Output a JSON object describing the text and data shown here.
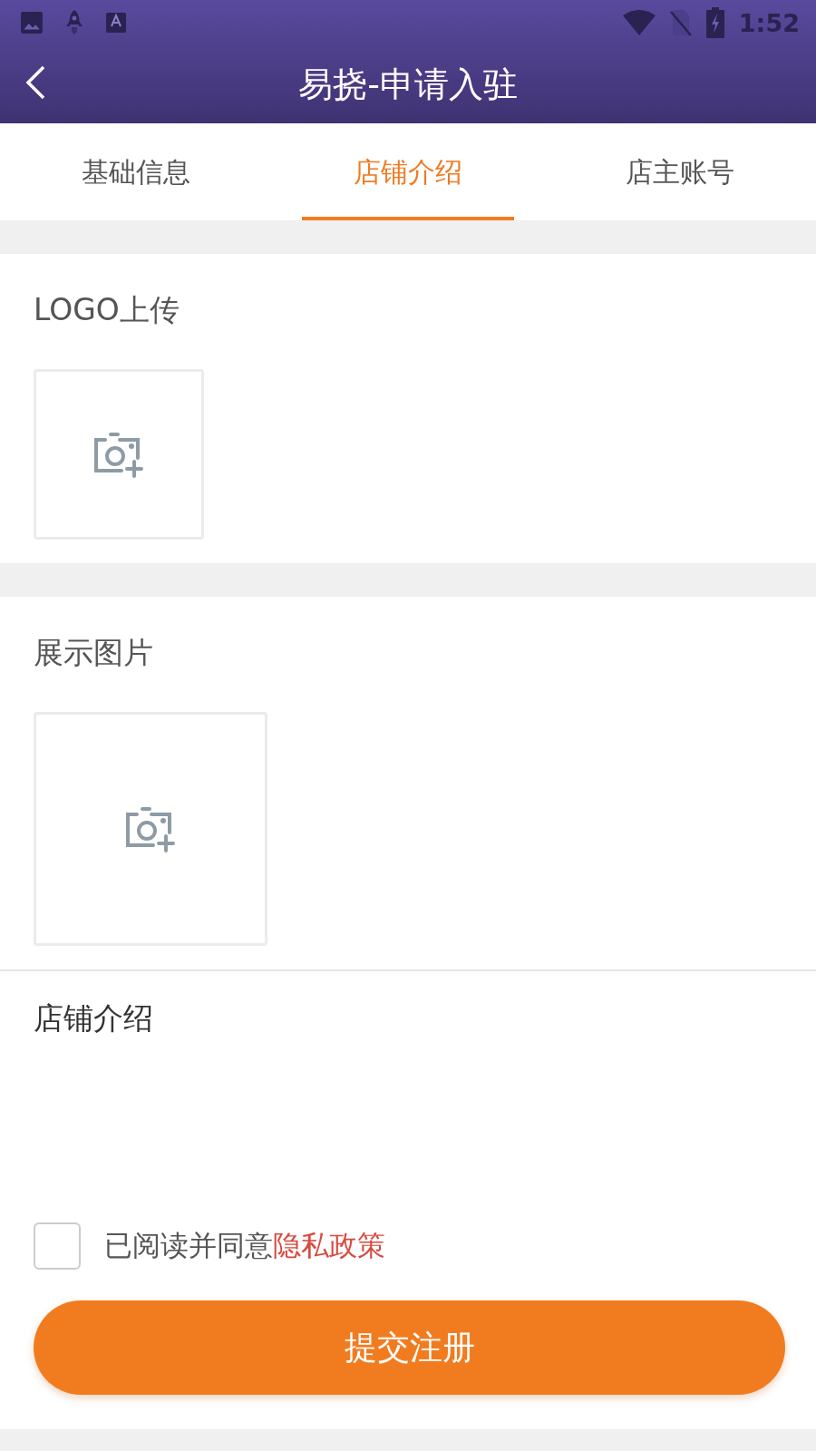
{
  "status_bar": {
    "time": "1:52"
  },
  "header": {
    "title": "易挠-申请入驻"
  },
  "tabs": [
    {
      "label": "基础信息",
      "selected": false
    },
    {
      "label": "店铺介绍",
      "selected": true
    },
    {
      "label": "店主账号",
      "selected": false
    }
  ],
  "sections": [
    {
      "kind": "logo",
      "label": "LOGO上传"
    },
    {
      "kind": "gallery",
      "label": "展示图片"
    },
    {
      "kind": "text",
      "label": "店铺介绍"
    }
  ],
  "agreement": {
    "checked": false,
    "text": "已阅读并同意",
    "link": "隐私政策"
  },
  "submit_button": "提交注册"
}
